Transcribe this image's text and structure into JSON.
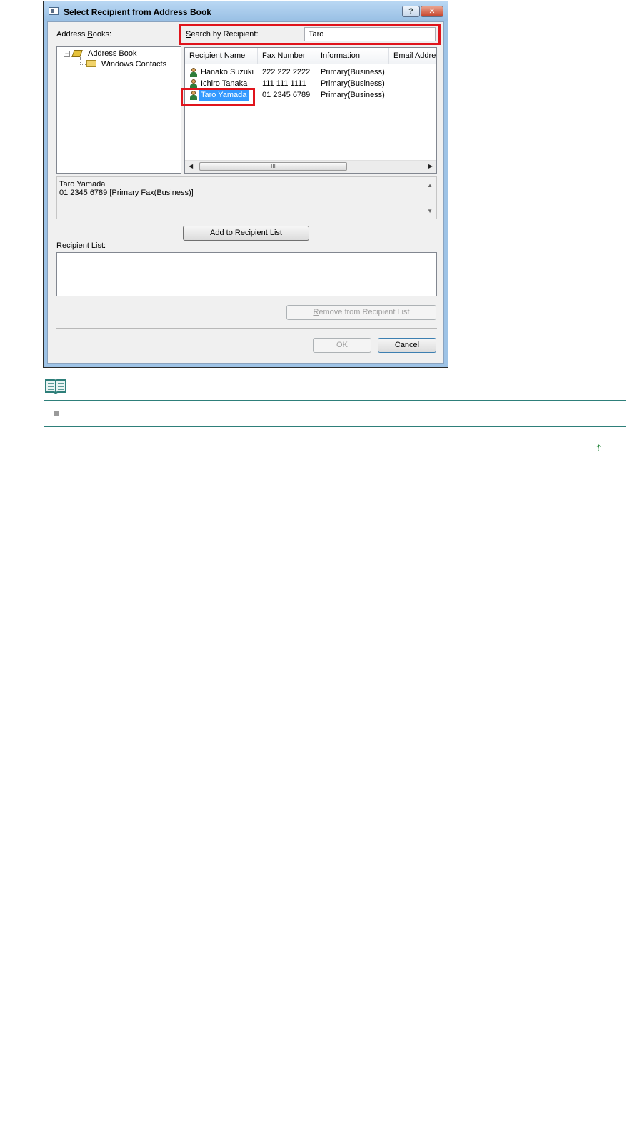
{
  "dialog": {
    "title": "Select Recipient from Address Book",
    "help_label": "?",
    "close_label": "✕"
  },
  "address_books": {
    "label_pre": "Address ",
    "label_underlined": "B",
    "label_post": "ooks:",
    "items": [
      {
        "label": "Address Book",
        "icon": "address-book-icon"
      },
      {
        "label": "Windows Contacts",
        "icon": "folder-icon"
      }
    ]
  },
  "search": {
    "label_underlined": "S",
    "label_post": "earch by Recipient:",
    "value": "Taro"
  },
  "list": {
    "columns": [
      "Recipient Name",
      "Fax Number",
      "Information",
      "Email Addre"
    ],
    "rows": [
      {
        "name": "Hanako Suzuki",
        "fax": "222 222 2222",
        "info": "Primary(Business)",
        "email": ""
      },
      {
        "name": "Ichiro Tanaka",
        "fax": "111 111 1111",
        "info": "Primary(Business)",
        "email": ""
      },
      {
        "name": "Taro Yamada",
        "fax": "01 2345 6789",
        "info": "Primary(Business)",
        "email": ""
      }
    ],
    "selected_index": 2,
    "scroll_left": "◀",
    "scroll_right": "▶",
    "thumb_grip": "III"
  },
  "detail": {
    "line1": "Taro Yamada",
    "line2": "01 2345 6789 [Primary Fax(Business)]"
  },
  "buttons": {
    "add_pre": "Add to Recipient ",
    "add_underlined": "L",
    "add_post": "ist",
    "remove_underlined": "R",
    "remove_post": "emove from Recipient List",
    "ok": "OK",
    "cancel": "Cancel"
  },
  "recipient_list": {
    "label_pre": "R",
    "label_underlined": "e",
    "label_post": "cipient List:"
  },
  "colors": {
    "highlight_frame": "#e0141c",
    "selection": "#3399ff",
    "note_rule": "#2e7f7a"
  },
  "page_nav": {
    "top_arrow": "⇡"
  }
}
